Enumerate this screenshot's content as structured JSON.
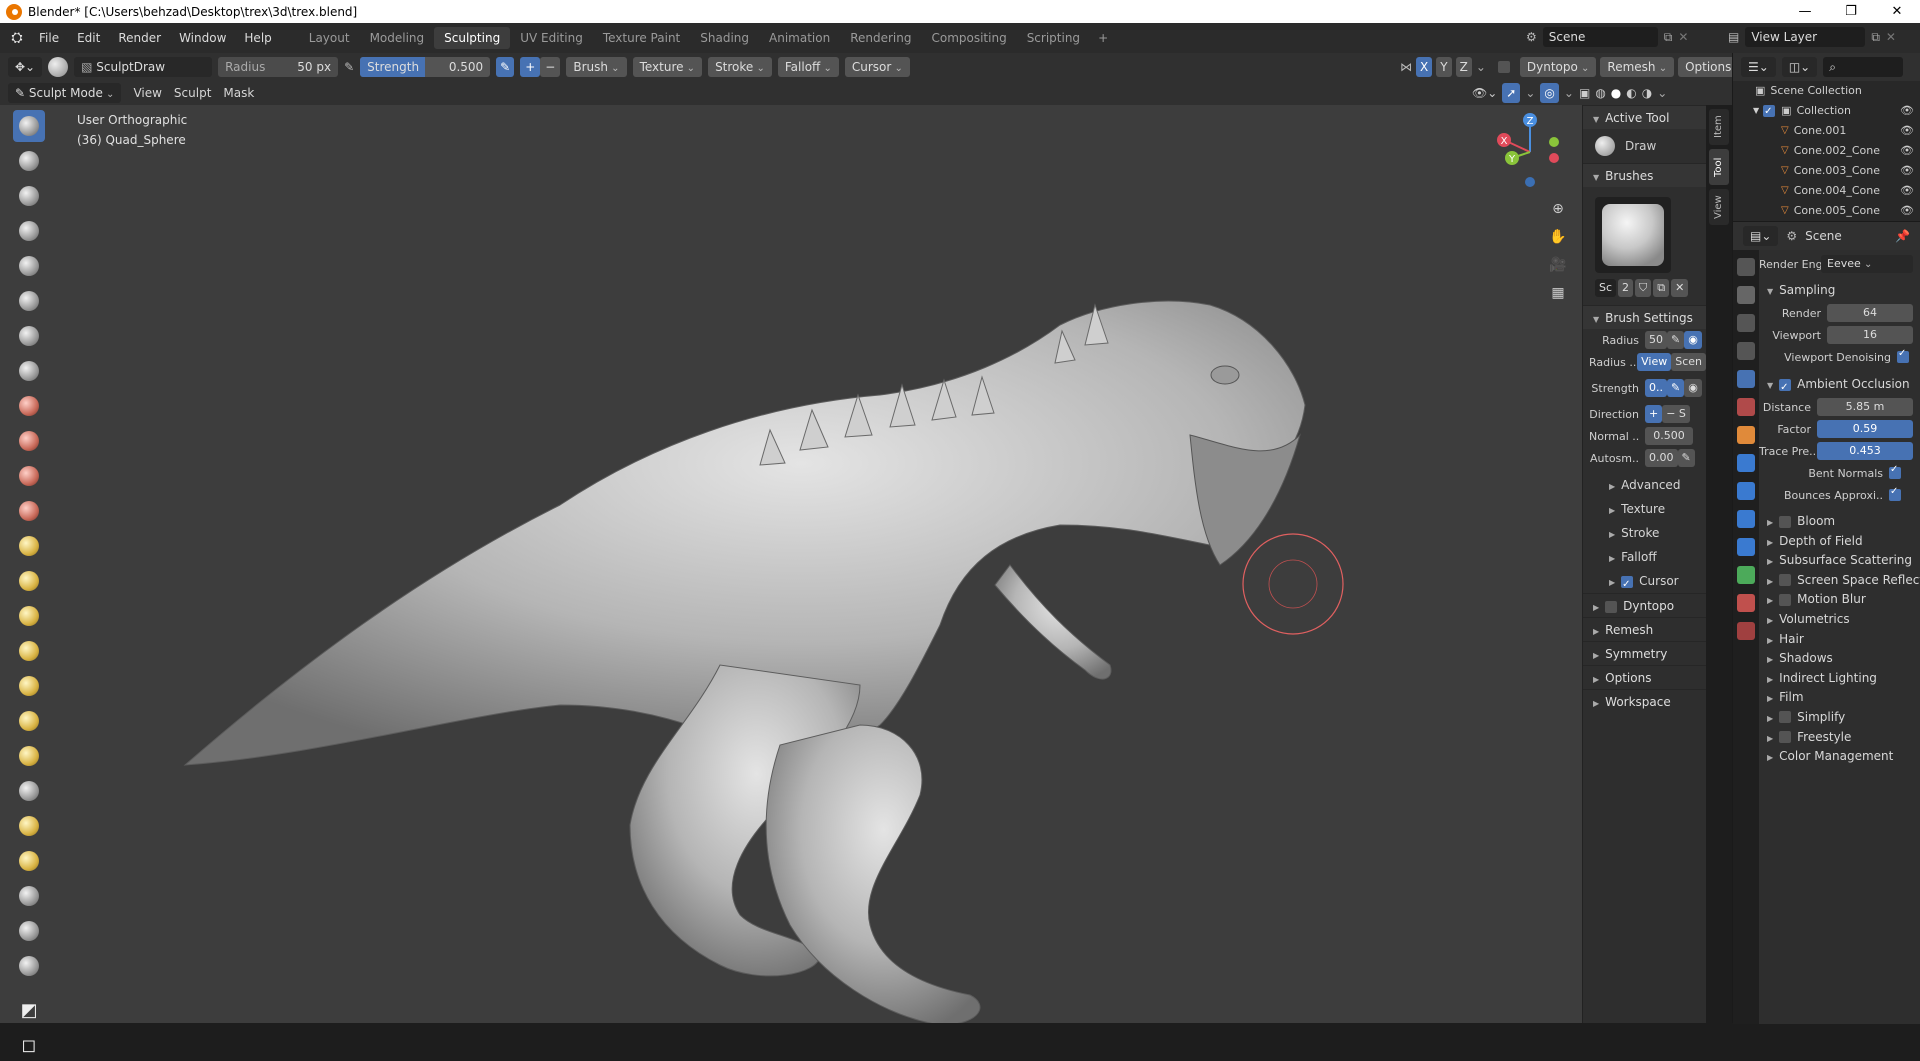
{
  "window": {
    "title": "Blender* [C:\\Users\\behzad\\Desktop\\trex\\3d\\trex.blend]",
    "buttons": [
      "—",
      "❐",
      "✕"
    ]
  },
  "menu": [
    "File",
    "Edit",
    "Render",
    "Window",
    "Help"
  ],
  "workspaces": [
    "Layout",
    "Modeling",
    "Sculpting",
    "UV Editing",
    "Texture Paint",
    "Shading",
    "Animation",
    "Rendering",
    "Compositing",
    "Scripting"
  ],
  "active_workspace": "Sculpting",
  "scene": {
    "label": "Scene",
    "view_layer": "View Layer"
  },
  "tool_header": {
    "brush_name": "SculptDraw",
    "radius_label": "Radius",
    "radius_value": "50 px",
    "strength_label": "Strength",
    "strength_value": "0.500",
    "strength_fraction": 0.5,
    "plus": "+",
    "minus": "−",
    "menus": [
      "Brush",
      "Texture",
      "Stroke",
      "Falloff",
      "Cursor"
    ],
    "axes": [
      "X",
      "Y",
      "Z"
    ],
    "dyntopo": "Dyntopo",
    "remesh": "Remesh",
    "options": "Options"
  },
  "mode_header": {
    "mode": "Sculpt Mode",
    "menus": [
      "View",
      "Sculpt",
      "Mask"
    ]
  },
  "viewport": {
    "view_name": "User Orthographic",
    "object_info": "(36) Quad_Sphere",
    "gizmo": {
      "x": "X",
      "y": "Y",
      "z": "Z"
    }
  },
  "side_tabs": [
    "Item",
    "Tool",
    "View"
  ],
  "npanel": {
    "active_tool_header": "Active Tool",
    "active_tool": "Draw",
    "brushes_header": "Brushes",
    "brush_slot": "Sc",
    "brush_users": "2",
    "brush_settings_header": "Brush Settings",
    "rows": [
      {
        "label": "Radius",
        "value": "50"
      },
      {
        "label": "Radius ..",
        "value": "View",
        "value2": "Scen"
      },
      {
        "label": "Strength",
        "value": "0.."
      },
      {
        "label": "Direction",
        "value": "+",
        "value2": "− S"
      },
      {
        "label": "Normal ..",
        "value": "0.500"
      },
      {
        "label": "Autosm..",
        "value": "0.00"
      }
    ],
    "subsections": [
      "Advanced",
      "Texture",
      "Stroke",
      "Falloff",
      "Cursor"
    ],
    "sections": [
      "Dyntopo",
      "Remesh",
      "Symmetry",
      "Options",
      "Workspace"
    ]
  },
  "outliner": {
    "root": "Scene Collection",
    "collection": "Collection",
    "items": [
      "Cone.001",
      "Cone.002_Cone",
      "Cone.003_Cone",
      "Cone.004_Cone",
      "Cone.005_Cone"
    ]
  },
  "properties": {
    "context": "Scene",
    "render_engine_label": "Render Eng..",
    "render_engine": "Eevee",
    "sampling_header": "Sampling",
    "render_label": "Render",
    "render_samples": "64",
    "viewport_label": "Viewport",
    "viewport_samples": "16",
    "viewport_denoising": "Viewport Denoising",
    "ao_header": "Ambient Occlusion",
    "distance_label": "Distance",
    "distance": "5.85 m",
    "factor_label": "Factor",
    "factor": "0.59",
    "trace_label": "Trace Pre..",
    "trace": "0.453",
    "bent_normals": "Bent Normals",
    "bounces": "Bounces Approxi..",
    "panels": [
      {
        "name": "Bloom",
        "checkbox": true
      },
      {
        "name": "Depth of Field",
        "checkbox": false
      },
      {
        "name": "Subsurface Scattering",
        "checkbox": false
      },
      {
        "name": "Screen Space Reflecti",
        "checkbox": true
      },
      {
        "name": "Motion Blur",
        "checkbox": true
      },
      {
        "name": "Volumetrics",
        "checkbox": false
      },
      {
        "name": "Hair",
        "checkbox": false
      },
      {
        "name": "Shadows",
        "checkbox": false
      },
      {
        "name": "Indirect Lighting",
        "checkbox": false
      },
      {
        "name": "Film",
        "checkbox": false
      },
      {
        "name": "Simplify",
        "checkbox": true
      },
      {
        "name": "Freestyle",
        "checkbox": true
      },
      {
        "name": "Color Management",
        "checkbox": false
      }
    ]
  },
  "colors": {
    "accent": "#4772b3",
    "viewport_bg": "#3d3d3d",
    "panel_bg": "#2e2e2e"
  }
}
